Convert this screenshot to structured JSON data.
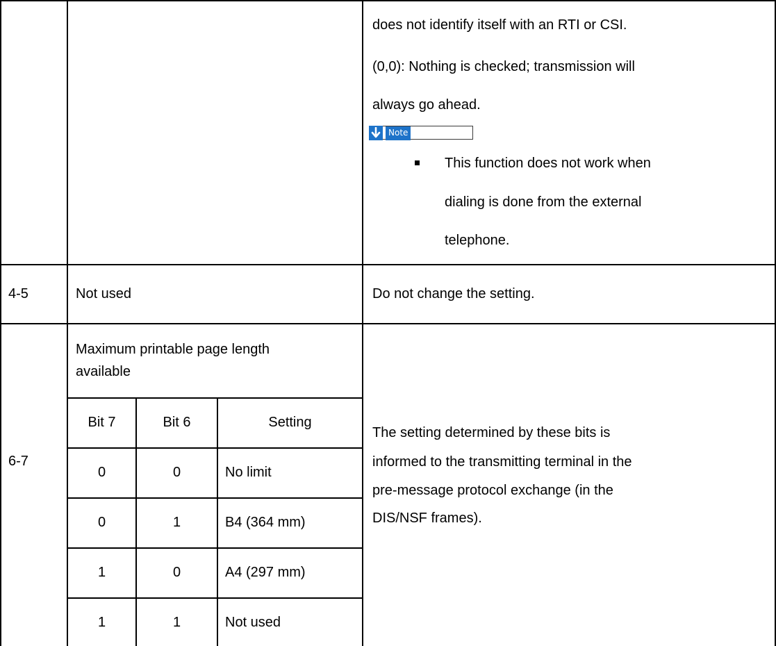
{
  "table": {
    "cont_desc_lines": [
      "does not identify itself with an RTI or CSI.",
      "(0,0): Nothing is checked; transmission will",
      "always go ahead."
    ],
    "note_label": "Note",
    "note_bullet_lines": [
      "This function does not work when",
      "dialing is done from the external",
      "telephone."
    ],
    "row_4_5": {
      "bit": "4-5",
      "function": "Not used",
      "description": "Do not change the setting."
    },
    "row_6_7": {
      "bit": "6-7",
      "function_lines": [
        "Maximum printable page length",
        "available"
      ],
      "sub_headers": [
        "Bit 7",
        "Bit 6",
        "Setting"
      ],
      "sub_rows": [
        [
          "0",
          "0",
          "No limit"
        ],
        [
          "0",
          "1",
          "B4 (364 mm)"
        ],
        [
          "1",
          "0",
          "A4 (297 mm)"
        ],
        [
          "1",
          "1",
          "Not used"
        ]
      ],
      "description_lines": [
        "The setting determined by these bits is",
        "informed to the transmitting terminal in the",
        "pre-message protocol exchange (in the",
        "DIS/NSF frames)."
      ]
    }
  },
  "colors": {
    "note_accent": "#1e73c9"
  }
}
